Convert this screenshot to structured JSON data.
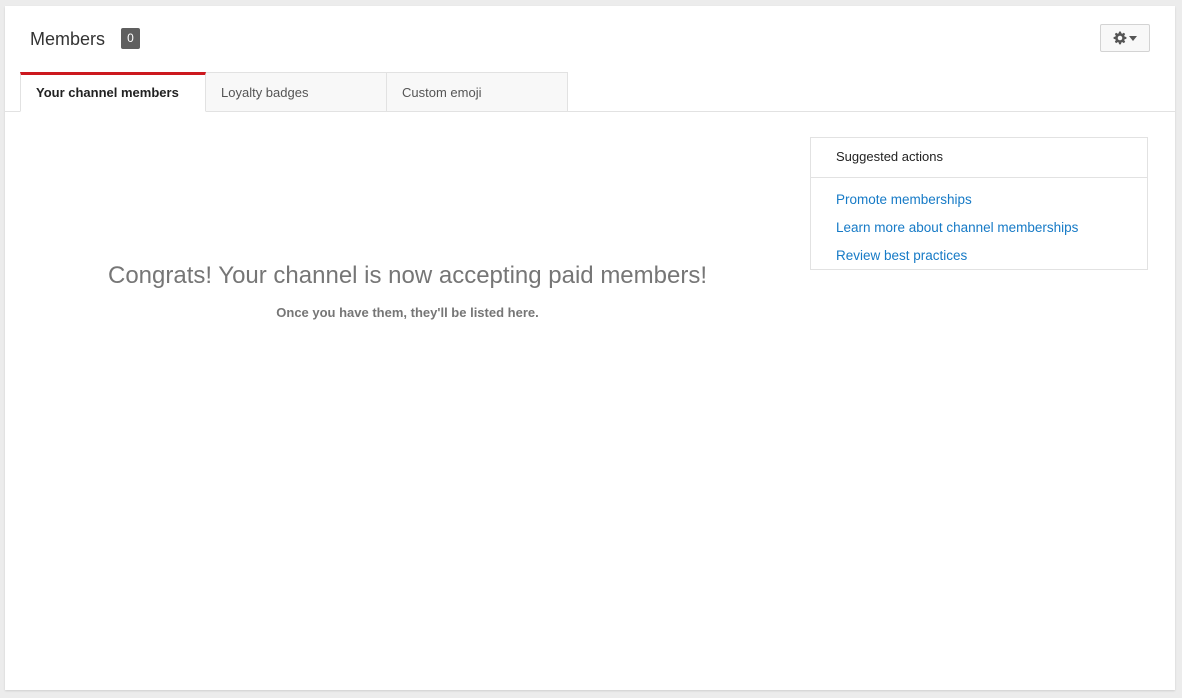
{
  "header": {
    "title": "Members",
    "member_count": "0",
    "settings_icon": "gear-icon",
    "dropdown_icon": "caret-down-icon"
  },
  "tabs": [
    {
      "label": "Your channel members",
      "active": true
    },
    {
      "label": "Loyalty badges",
      "active": false
    },
    {
      "label": "Custom emoji",
      "active": false
    }
  ],
  "empty_state": {
    "heading": "Congrats! Your channel is now accepting paid members!",
    "subtext": "Once you have them, they'll be listed here."
  },
  "suggested_actions": {
    "title": "Suggested actions",
    "links": [
      "Promote memberships",
      "Learn more about channel memberships",
      "Review best practices"
    ]
  },
  "colors": {
    "accent_tab": "#cc181e",
    "link": "#167ac6",
    "badge": "#5f5f5f"
  }
}
